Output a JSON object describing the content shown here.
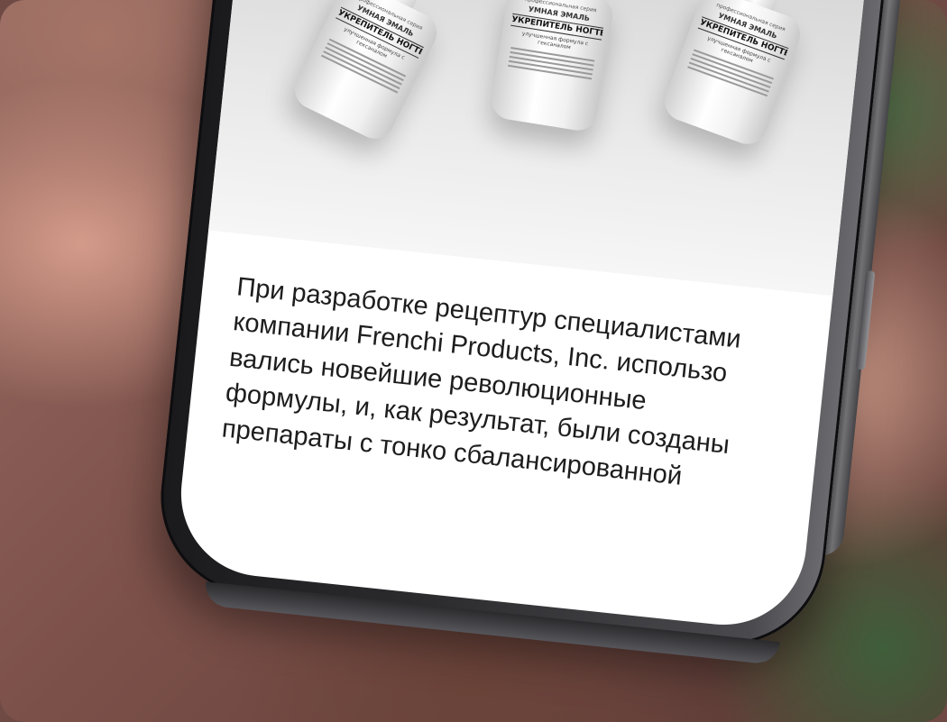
{
  "bottle_label": {
    "top_line": "профессиональная серия",
    "brand": "УМНАЯ ЭМАЛЬ",
    "name": "УКРЕПИТЕЛЬ НОГТЕЙ",
    "sub": "улучшенная формула с гексаналом"
  },
  "description": {
    "lines": [
      "При разработке рецептур специалистами",
      "компании Frenchi Products, Inc. использо",
      "вались новейшие революционные",
      "формулы, и, как результат, были созданы",
      "препараты с тонко сбалансированной"
    ]
  },
  "colors": {
    "screen_background": "#ffffff",
    "text": "#1d1d1d",
    "phone_frame": "#2b2b2e"
  }
}
